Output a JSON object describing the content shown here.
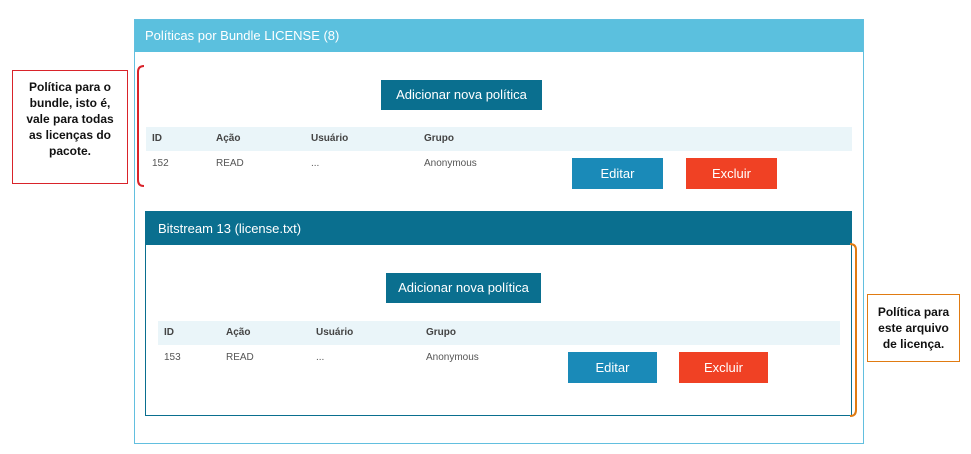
{
  "bundle_panel": {
    "title": "Políticas por Bundle LICENSE (8)",
    "add_label": "Adicionar nova política",
    "columns": [
      "ID",
      "Ação",
      "Usuário",
      "Grupo"
    ],
    "row": {
      "id": "152",
      "action": "READ",
      "user": "...",
      "group": "Anonymous"
    },
    "edit_label": "Editar",
    "delete_label": "Excluir"
  },
  "bitstream_panel": {
    "title": "Bitstream 13 (license.txt)",
    "add_label": "Adicionar nova política",
    "columns": [
      "ID",
      "Ação",
      "Usuário",
      "Grupo"
    ],
    "row": {
      "id": "153",
      "action": "READ",
      "user": "...",
      "group": "Anonymous"
    },
    "edit_label": "Editar",
    "delete_label": "Excluir"
  },
  "annotations": {
    "left_note": [
      "Política para o",
      "bundle, isto é,",
      "vale para todas",
      "as licenças do",
      "pacote."
    ],
    "right_note": [
      "Política para",
      "este arquivo",
      "de licença."
    ]
  },
  "colors": {
    "bundle_header": "#5bc0de",
    "bitstream_header": "#0a6f8f",
    "edit_button": "#1a8ab8",
    "delete_button": "#f04124",
    "left_bracket": "#d9232a",
    "right_bracket": "#e07b12"
  }
}
